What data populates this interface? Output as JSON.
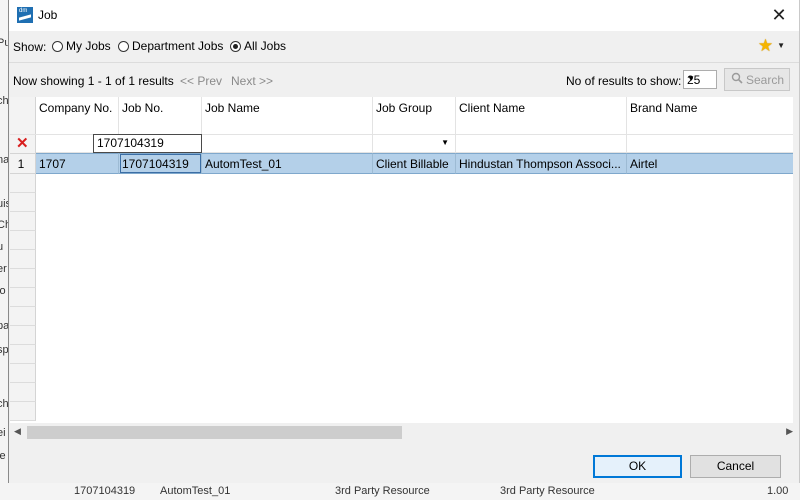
{
  "background": {
    "left_fragments": [
      "Pu",
      "ch",
      "na",
      "uis",
      "Ch",
      "u",
      "er",
      "lo",
      "pa",
      "sp",
      "ch",
      "ei",
      "ie"
    ],
    "bottom_fragments": [
      "1707104319",
      "AutomTest_01",
      "3rd Party Resource",
      "3rd Party Resource",
      "1.00"
    ]
  },
  "dialog": {
    "title": "Job",
    "app_icon_text": "dm",
    "close_glyph": "✕"
  },
  "show": {
    "label": "Show:",
    "options": [
      "My Jobs",
      "Department Jobs",
      "All Jobs"
    ],
    "selected": "All Jobs"
  },
  "paging": {
    "status": "Now showing 1 - 1 of 1 results",
    "prev_label": "<< Prev",
    "next_label": "Next >>",
    "results_label": "No of results to show:",
    "results_value": "25",
    "search_label": "Search"
  },
  "grid": {
    "columns": [
      "Company No.",
      "Job No.",
      "Job Name",
      "Job Group",
      "Client Name",
      "Brand Name"
    ],
    "filter": {
      "job_no": "1707104319"
    },
    "rows": [
      {
        "index": "1",
        "company_no": "1707",
        "job_no": "1707104319",
        "job_name": "AutomTest_01",
        "job_group": "Client Billable",
        "client_name": "Hindustan Thompson Associ...",
        "brand_name": "Airtel"
      }
    ]
  },
  "buttons": {
    "ok": "OK",
    "cancel": "Cancel"
  },
  "colors": {
    "selected_row": "#b4d0e9",
    "ok_border": "#0078d7",
    "star": "#f5b400",
    "clear_filter": "#d81e1e"
  }
}
